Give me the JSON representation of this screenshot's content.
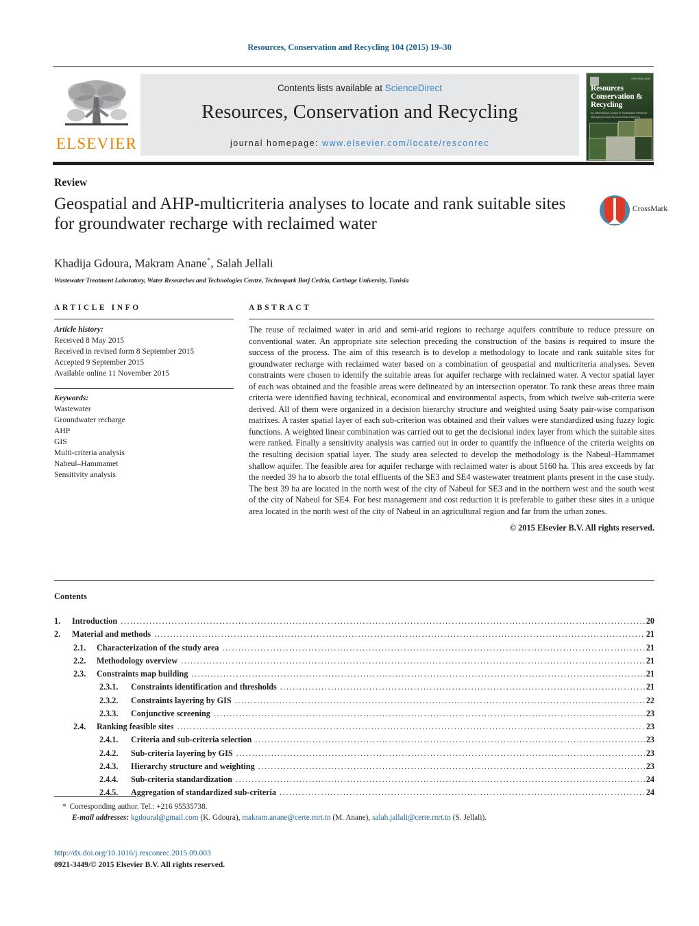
{
  "running_head": "Resources, Conservation and Recycling 104 (2015) 19–30",
  "masthead": {
    "publisher_name": "ELSEVIER",
    "contents_prefix": "Contents lists available at ",
    "contents_link": "ScienceDirect",
    "journal_title": "Resources, Conservation and Recycling",
    "homepage_prefix": "journal homepage: ",
    "homepage_url": "www.elsevier.com/locate/resconrec",
    "cover": {
      "title": "Resources Conservation & Recycling",
      "subtitle": "An International Journal of Sustainable Resource Management and Environmental Efficiency",
      "issn_corner": "ISSN 0921-3449"
    }
  },
  "article": {
    "type": "Review",
    "title": "Geospatial and AHP-multicriteria analyses to locate and rank suitable sites for groundwater recharge with reclaimed water",
    "authors": "Khadija Gdoura, Makram Anane",
    "authors_marker": "*",
    "authors_tail": ", Salah Jellali",
    "affiliation": "Wastewater Treatment Laboratory, Water Researches and Technologies Centre, Technopark Borj Cedria, Carthage University, Tunisia",
    "crossmark_label": "CrossMark"
  },
  "article_info": {
    "heading": "ARTICLE INFO",
    "history_label": "Article history:",
    "history": [
      "Received 8 May 2015",
      "Received in revised form 8 September 2015",
      "Accepted 9 September 2015",
      "Available online 11 November 2015"
    ],
    "keywords_label": "Keywords:",
    "keywords": [
      "Wastewater",
      "Groundwater recharge",
      "AHP",
      "GIS",
      "Multi-criteria analysis",
      "Nabeul–Hammamet",
      "Sensitivity analysis"
    ]
  },
  "abstract": {
    "heading": "ABSTRACT",
    "text": "The reuse of reclaimed water in arid and semi-arid regions to recharge aquifers contribute to reduce pressure on conventional water. An appropriate site selection preceding the construction of the basins is required to insure the success of the process. The aim of this research is to develop a methodology to locate and rank suitable sites for groundwater recharge with reclaimed water based on a combination of geospatial and multicriteria analyses. Seven constraints were chosen to identify the suitable areas for aquifer recharge with reclaimed water. A vector spatial layer of each was obtained and the feasible areas were delineated by an intersection operator. To rank these areas three main criteria were identified having technical, economical and environmental aspects, from which twelve sub-criteria were derived. All of them were organized in a decision hierarchy structure and weighted using Saaty pair-wise comparison matrixes. A raster spatial layer of each sub-criterion was obtained and their values were standardized using fuzzy logic functions. A weighted linear combination was carried out to get the decisional index layer from which the suitable sites were ranked. Finally a sensitivity analysis was carried out in order to quantify the influence of the criteria weights on the resulting decision spatial layer. The study area selected to develop the methodology is the Nabeul–Hammamet shallow aquifer. The feasible area for aquifer recharge with reclaimed water is about 5160 ha. This area exceeds by far the needed 39 ha to absorb the total effluents of the SE3 and SE4 wastewater treatment plants present in the case study. The best 39 ha are located in the north west of the city of Nabeul for SE3 and in the northern west and the south west of the city of Nabeul for SE4. For best management and cost reduction it is preferable to gather these sites in a unique area located in the north west of the city of Nabeul in an agricultural region and far from the urban zones.",
    "copyright": "© 2015 Elsevier B.V. All rights reserved."
  },
  "contents": {
    "heading": "Contents",
    "entries": [
      {
        "level": 1,
        "number": "1.",
        "label": "Introduction",
        "page": "20"
      },
      {
        "level": 1,
        "number": "2.",
        "label": "Material and methods",
        "page": "21"
      },
      {
        "level": 2,
        "number": "2.1.",
        "label": "Characterization of the study area",
        "page": "21"
      },
      {
        "level": 2,
        "number": "2.2.",
        "label": "Methodology overview",
        "page": "21"
      },
      {
        "level": 2,
        "number": "2.3.",
        "label": "Constraints map building",
        "page": "21"
      },
      {
        "level": 3,
        "number": "2.3.1.",
        "label": "Constraints identification and thresholds",
        "page": "21"
      },
      {
        "level": 3,
        "number": "2.3.2.",
        "label": "Constraints layering by GIS",
        "page": "22"
      },
      {
        "level": 3,
        "number": "2.3.3.",
        "label": "Conjunctive screening",
        "page": "23"
      },
      {
        "level": 2,
        "number": "2.4.",
        "label": "Ranking feasible sites",
        "page": "23"
      },
      {
        "level": 3,
        "number": "2.4.1.",
        "label": "Criteria and sub-criteria selection",
        "page": "23"
      },
      {
        "level": 3,
        "number": "2.4.2.",
        "label": "Sub-criteria layering by GIS",
        "page": "23"
      },
      {
        "level": 3,
        "number": "2.4.3.",
        "label": "Hierarchy structure and weighting",
        "page": "23"
      },
      {
        "level": 3,
        "number": "2.4.4.",
        "label": "Sub-criteria standardization",
        "page": "24"
      },
      {
        "level": 3,
        "number": "2.4.5.",
        "label": "Aggregation of standardized sub-criteria",
        "page": "24"
      }
    ]
  },
  "footnotes": {
    "star": "*",
    "corresponding": "Corresponding author. Tel.: +216 95535738.",
    "email_label": "E-mail addresses:",
    "emails": [
      {
        "address": "kgdoural@gmail.com",
        "owner": "(K. Gdoura),"
      },
      {
        "address": "makram.anane@certe.rnrt.tn",
        "owner": "(M. Anane),"
      },
      {
        "address": "salah.jallali@certe.rnrt.tn",
        "owner": "(S. Jellali)."
      }
    ]
  },
  "bottom": {
    "doi": "http://dx.doi.org/10.1016/j.resconrec.2015.09.003",
    "issn_line": "0921-3449/© 2015 Elsevier B.V. All rights reserved."
  }
}
